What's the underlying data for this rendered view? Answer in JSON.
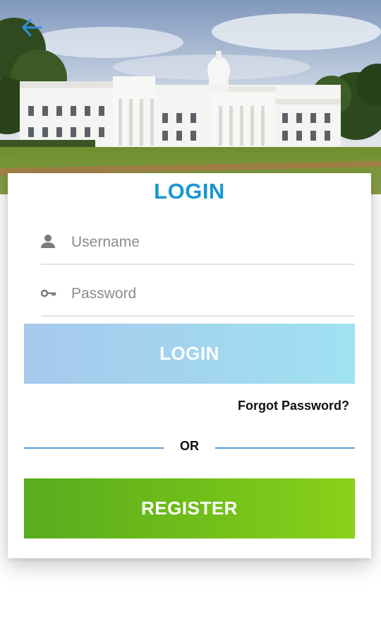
{
  "header": {
    "back_icon": "arrow-left-icon",
    "image": "campus-building-photo"
  },
  "login_card": {
    "title": "LOGIN",
    "username": {
      "icon": "person-icon",
      "placeholder": "Username",
      "value": ""
    },
    "password": {
      "icon": "key-icon",
      "placeholder": "Password",
      "value": ""
    },
    "login_button_label": "LOGIN",
    "forgot_password_label": "Forgot Password?",
    "divider_label": "OR",
    "register_button_label": "REGISTER"
  },
  "colors": {
    "title": "#1996d3",
    "login_button": "#a2d6ef",
    "register_button": "#6fbd1a",
    "divider": "#5b9bd4",
    "back_arrow": "#2f8fe0"
  }
}
